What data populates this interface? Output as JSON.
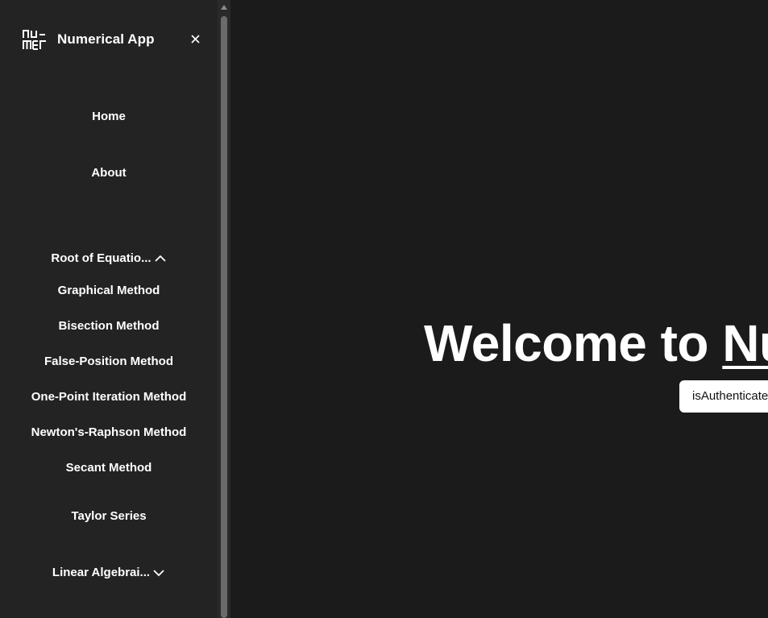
{
  "sidebar": {
    "brand": "Numerical App",
    "nav": {
      "home": "Home",
      "about": "About"
    },
    "root_menu": {
      "label": "Root of Equatio...",
      "expanded": true,
      "items": [
        "Graphical Method",
        "Bisection Method",
        "False-Position Method",
        "One-Point Iteration Method",
        "Newton's-Raphson Method",
        "Secant Method"
      ]
    },
    "taylor": "Taylor Series",
    "linear_menu": {
      "label": "Linear Algebrai...",
      "expanded": false
    }
  },
  "main": {
    "welcome_prefix": "Welcome to ",
    "welcome_app": "Numerical App",
    "auth_label": "isAuthenticated"
  },
  "icons": {
    "logo": "numer-logo-icon",
    "close": "close-icon",
    "chevron_up": "chevron-up-icon",
    "chevron_down": "chevron-down-icon"
  },
  "colors": {
    "main_bg": "#1b1b1b",
    "sidebar_bg": "#232323",
    "text": "#ffffff"
  }
}
